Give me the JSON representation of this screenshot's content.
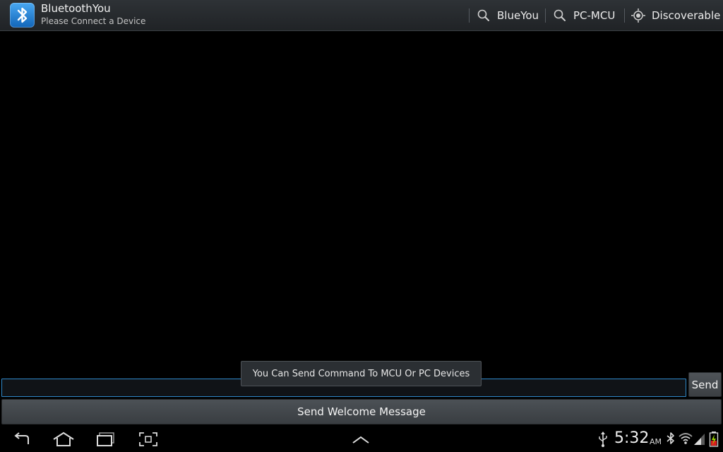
{
  "app": {
    "title": "BluetoothYou",
    "subtitle": "Please Connect a Device"
  },
  "actions": {
    "blueyou_label": "BlueYou",
    "pcmcu_label": "PC-MCU",
    "discoverable_label": "Discoverable"
  },
  "input": {
    "value": "",
    "placeholder": ""
  },
  "send_label": "Send",
  "welcome_label": "Send Welcome Message",
  "toast": "You Can Send Command To MCU Or PC Devices",
  "status": {
    "time": "5:32",
    "ampm": "AM"
  },
  "icons": {
    "app": "bluetooth-icon",
    "action_search": "search-icon",
    "action_discoverable": "discoverable-target-icon",
    "nav": [
      "back-icon",
      "home-icon",
      "recent-apps-icon",
      "screenshot-icon",
      "chevron-up-icon"
    ],
    "status": [
      "usb-icon",
      "bluetooth-icon",
      "wifi-icon",
      "signal-icon",
      "battery-icon"
    ]
  },
  "colors": {
    "accent": "#2f88c9",
    "app_icon": "#2a86d8",
    "battery": "#d81e1e"
  }
}
